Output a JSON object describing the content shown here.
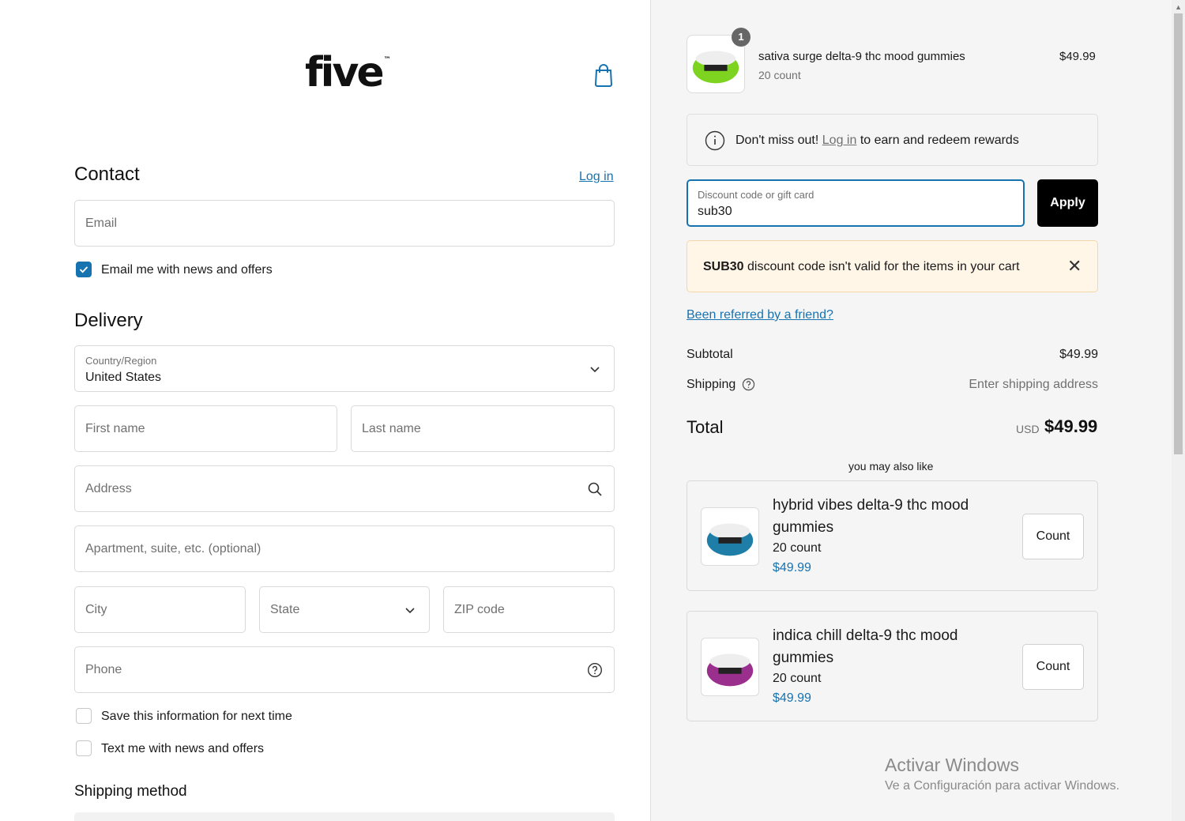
{
  "brand": {
    "logo_text": "five",
    "tm": "™"
  },
  "contact": {
    "heading": "Contact",
    "login_label": "Log in",
    "email_placeholder": "Email",
    "email_news_label": "Email me with news and offers",
    "email_news_checked": true
  },
  "delivery": {
    "heading": "Delivery",
    "country_label": "Country/Region",
    "country_value": "United States",
    "first_name_placeholder": "First name",
    "last_name_placeholder": "Last name",
    "address_placeholder": "Address",
    "apartment_placeholder": "Apartment, suite, etc. (optional)",
    "city_placeholder": "City",
    "state_placeholder": "State",
    "zip_placeholder": "ZIP code",
    "phone_placeholder": "Phone",
    "save_info_label": "Save this information for next time",
    "text_news_label": "Text me with news and offers"
  },
  "shipping_method": {
    "heading": "Shipping method"
  },
  "cart": {
    "item": {
      "quantity": "1",
      "name": "sativa surge delta-9 thc mood gummies",
      "variant": "20 count",
      "price": "$49.99"
    },
    "rewards": {
      "prefix": "Don't miss out!",
      "login_label": "Log in",
      "suffix": "to earn and redeem rewards"
    },
    "discount": {
      "label": "Discount code or gift card",
      "value": "sub30",
      "apply_label": "Apply"
    },
    "error": {
      "code": "SUB30",
      "message": "discount code isn't valid for the items in your cart"
    },
    "referral_label": "Been referred by a friend?",
    "subtotal_label": "Subtotal",
    "subtotal_value": "$49.99",
    "shipping_label": "Shipping",
    "shipping_value": "Enter shipping address",
    "total_label": "Total",
    "total_currency": "USD",
    "total_value": "$49.99"
  },
  "upsell": {
    "title": "you may also like",
    "items": [
      {
        "name": "hybrid vibes delta-9 thc mood gummies",
        "variant": "20 count",
        "price": "$49.99",
        "button": "Count",
        "color": "#1f7ea8"
      },
      {
        "name": "indica chill delta-9 thc mood gummies",
        "variant": "20 count",
        "price": "$49.99",
        "button": "Count",
        "color": "#9a2f8e"
      }
    ]
  },
  "cart_item_color": "#7ed321",
  "accent_color": "#1773b0",
  "watermark": {
    "line1": "Activar Windows",
    "line2": "Ve a Configuración para activar Windows."
  }
}
